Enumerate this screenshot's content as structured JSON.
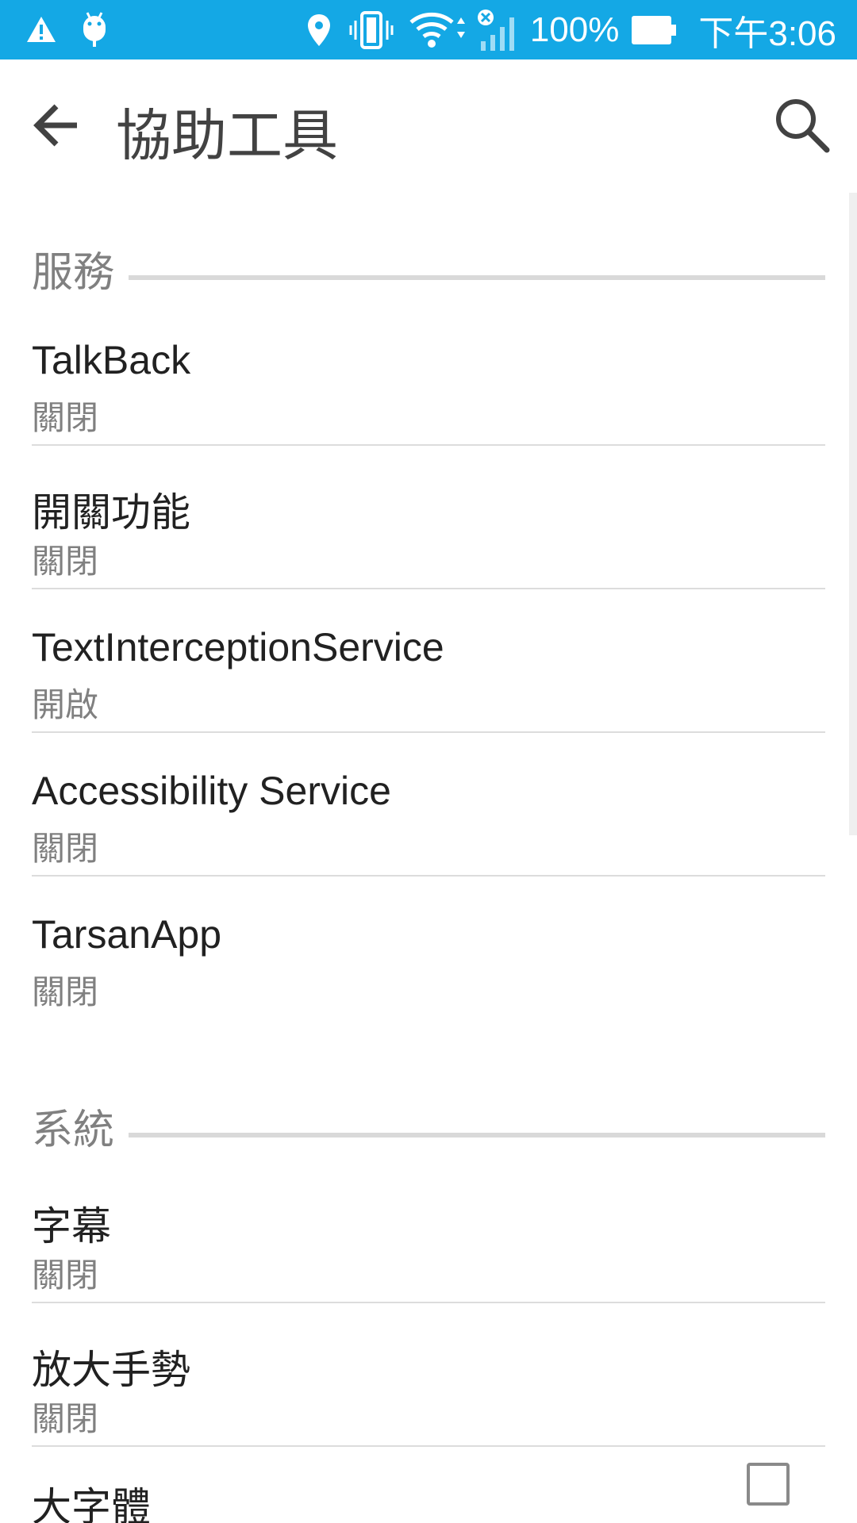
{
  "status_bar": {
    "battery_percent": "100%",
    "clock": "下午3:06",
    "icons": [
      "warning-icon",
      "android-debug-icon",
      "location-icon",
      "vibrate-icon",
      "wifi-icon",
      "signal-icon",
      "battery-icon"
    ]
  },
  "app_bar": {
    "title": "協助工具",
    "back_icon": "arrow-back-icon",
    "search_icon": "search-icon"
  },
  "sections": [
    {
      "title": "服務",
      "items": [
        {
          "title": "TalkBack",
          "summary": "關閉"
        },
        {
          "title": "開關功能",
          "summary": "關閉"
        },
        {
          "title": "TextInterceptionService",
          "summary": "開啟"
        },
        {
          "title": "Accessibility Service",
          "summary": "關閉"
        },
        {
          "title": "TarsanApp",
          "summary": "關閉"
        }
      ]
    },
    {
      "title": "系統",
      "items": [
        {
          "title": "字幕",
          "summary": "關閉"
        },
        {
          "title": "放大手勢",
          "summary": "關閉"
        },
        {
          "title": "大字體",
          "summary": ""
        }
      ]
    }
  ],
  "large_text_checked": false,
  "colors": {
    "status_bar": "#14a8e5",
    "title_text": "#424242",
    "summary_text": "#808080",
    "divider": "#dcdcdc"
  }
}
